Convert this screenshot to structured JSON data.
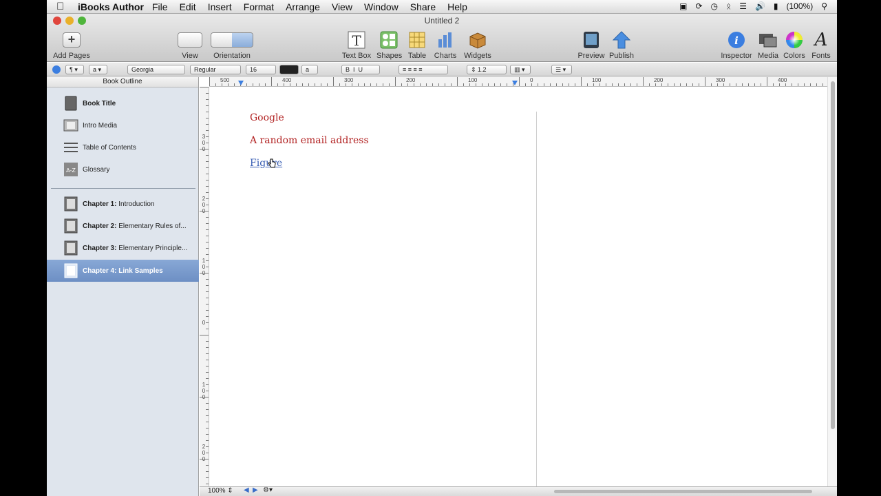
{
  "menubar": {
    "apple": "",
    "app_name": "iBooks Author",
    "menus": [
      "File",
      "Edit",
      "Insert",
      "Format",
      "Arrange",
      "View",
      "Window",
      "Share",
      "Help"
    ],
    "battery": "(100%)"
  },
  "window": {
    "title": "Untitled 2"
  },
  "toolbar": {
    "add_pages": "Add Pages",
    "view": "View",
    "orientation": "Orientation",
    "text_box": "Text Box",
    "shapes": "Shapes",
    "table": "Table",
    "charts": "Charts",
    "widgets": "Widgets",
    "preview": "Preview",
    "publish": "Publish",
    "inspector": "Inspector",
    "media": "Media",
    "colors": "Colors",
    "fonts": "Fonts"
  },
  "format_bar": {
    "paragraph_style": "¶",
    "char_style": "a",
    "font_family": "Georgia",
    "font_style": "Regular",
    "font_size": "16",
    "spacing": "1.2"
  },
  "sidebar": {
    "header": "Book Outline",
    "front_items": [
      {
        "label": "Book Title",
        "icon": "book-icon"
      },
      {
        "label": "Intro Media",
        "icon": "film-icon"
      },
      {
        "label": "Table of Contents",
        "icon": "list-icon"
      },
      {
        "label": "Glossary",
        "icon": "glossary-icon"
      }
    ],
    "chapters": [
      {
        "prefix": "Chapter 1:",
        "title": "Introduction"
      },
      {
        "prefix": "Chapter 2:",
        "title": "Elementary Rules of..."
      },
      {
        "prefix": "Chapter 3:",
        "title": "Elementary Principle..."
      },
      {
        "prefix": "Chapter 4:",
        "title": "Link Samples",
        "selected": true
      }
    ]
  },
  "ruler": {
    "h_labels": [
      "500",
      "400",
      "300",
      "200",
      "100",
      "0",
      "100",
      "200",
      "300",
      "400"
    ],
    "v_labels": [
      "300",
      "200",
      "100",
      "0",
      "100",
      "200"
    ]
  },
  "document": {
    "lines": [
      "Google",
      "A random email address",
      "Figure"
    ]
  },
  "status": {
    "zoom": "100%"
  },
  "colors": {
    "link_red": "#b22222",
    "link_blue": "#3a5fb4",
    "selection": "#7a9bce"
  }
}
